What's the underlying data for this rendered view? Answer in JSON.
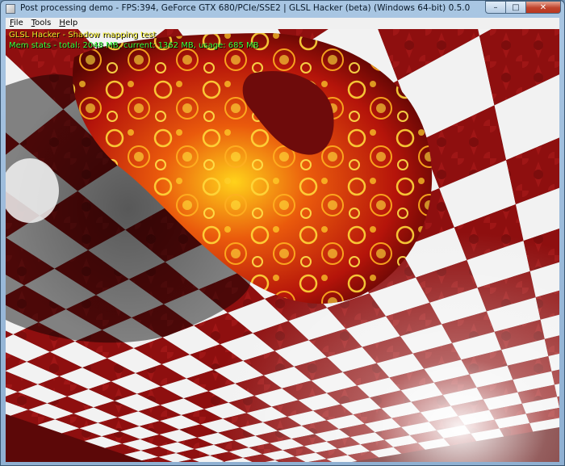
{
  "window": {
    "title": "Post processing demo - FPS:394, GeForce GTX 680/PCIe/SSE2 | GLSL Hacker (beta) (Windows 64-bit) 0.5.0"
  },
  "caption_buttons": {
    "minimize_glyph": "–",
    "maximize_glyph": "□",
    "close_glyph": "✕"
  },
  "menu": {
    "items": [
      {
        "mnemonic": "F",
        "rest": "ile"
      },
      {
        "mnemonic": "T",
        "rest": "ools"
      },
      {
        "mnemonic": "H",
        "rest": "elp"
      }
    ]
  },
  "overlay": {
    "line1": "GLSL Hacker - Shadow mapping test",
    "line2": "Mem stats - total: 2048 MB, current: 1362 MB, usage: 685 MB"
  },
  "colors": {
    "overlay_title": "#f0ea2a",
    "overlay_stats": "#3cff3c",
    "checker_red": "#8e0f0f",
    "checker_white": "#f2f2f2",
    "torus": "#c21a08"
  }
}
